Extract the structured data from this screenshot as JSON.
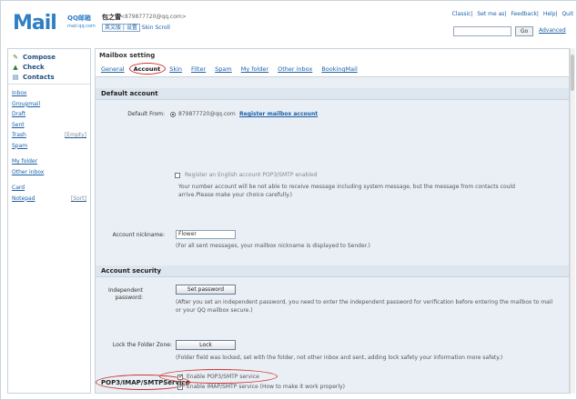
{
  "header": {
    "logo_mail": "Mail",
    "logo_brand": "QQ邮箱",
    "logo_domain": "mail.qq.com",
    "user_name": "包之雷",
    "user_email": "<879877720@qq.com>",
    "user_links": [
      "英文版 | 设置",
      "Skin",
      "Scroll"
    ],
    "top_links": [
      "Classic",
      "Set me as",
      "Feedback",
      "Help",
      "Quit"
    ],
    "search_button": "Go",
    "advanced": "Advanced"
  },
  "sidebar": {
    "actions": [
      {
        "label": "Compose",
        "icon": "compose-icon"
      },
      {
        "label": "Check",
        "icon": "check-mail-icon"
      },
      {
        "label": "Contacts",
        "icon": "contacts-icon"
      }
    ],
    "folders": [
      {
        "label": "Inbox",
        "sub": ""
      },
      {
        "label": "Groupmail",
        "sub": ""
      },
      {
        "label": "Draft",
        "sub": ""
      },
      {
        "label": "Sent",
        "sub": ""
      },
      {
        "label": "Trash",
        "sub": "[Empty]"
      },
      {
        "label": "Spam",
        "sub": ""
      }
    ],
    "folders2": [
      {
        "label": "My folder",
        "sub": ""
      },
      {
        "label": "Other inbox",
        "sub": ""
      }
    ],
    "folders3": [
      {
        "label": "Card",
        "sub": ""
      },
      {
        "label": "Notepad",
        "sub": "[Sort]"
      }
    ]
  },
  "main": {
    "title": "Mailbox setting",
    "tabs": [
      {
        "label": "General",
        "active": false
      },
      {
        "label": "Account",
        "active": true
      },
      {
        "label": "Skin",
        "active": false
      },
      {
        "label": "Filter",
        "active": false
      },
      {
        "label": "Spam",
        "active": false
      },
      {
        "label": "My folder",
        "active": false
      },
      {
        "label": "Other inbox",
        "active": false
      },
      {
        "label": "BookingMail",
        "active": false
      }
    ],
    "default_account": {
      "section": "Default account",
      "from_label": "Default From:",
      "from_value": "879877720@qq.com",
      "register_link": "Register mailbox account",
      "english_checkbox": "Register an English account POP3/SMTP enabled",
      "notice": "Your number account will be not able to receive message including system message, but the message from contacts could arrive.Please make your choice carefully.)",
      "nickname_label": "Account nickname:",
      "nickname_value": "Flower",
      "nickname_hint": "(For all sent messages, your mailbox nickname is displayed to Sender.)"
    },
    "security": {
      "section": "Account security",
      "independent_label": "Independent password:",
      "set_password_btn": "Set password",
      "independent_hint": "(After you set an independent password, you need to enter the independent password for verification before entering the mailbox to mail or your QQ mailbox secure.)",
      "lock_label": "Lock the Folder Zone:",
      "lock_btn": "Lock",
      "lock_hint": "(Folder field was locked, set with the folder, not other inbox and sent, adding lock safety your information more safety.)"
    },
    "pop3": {
      "section": "POP3/IMAP/SMTPService",
      "enable_pop3": "Enable POP3/SMTP service",
      "enable_imap": "Enable IMAP/SMTP service (How to make it work properly)"
    }
  }
}
